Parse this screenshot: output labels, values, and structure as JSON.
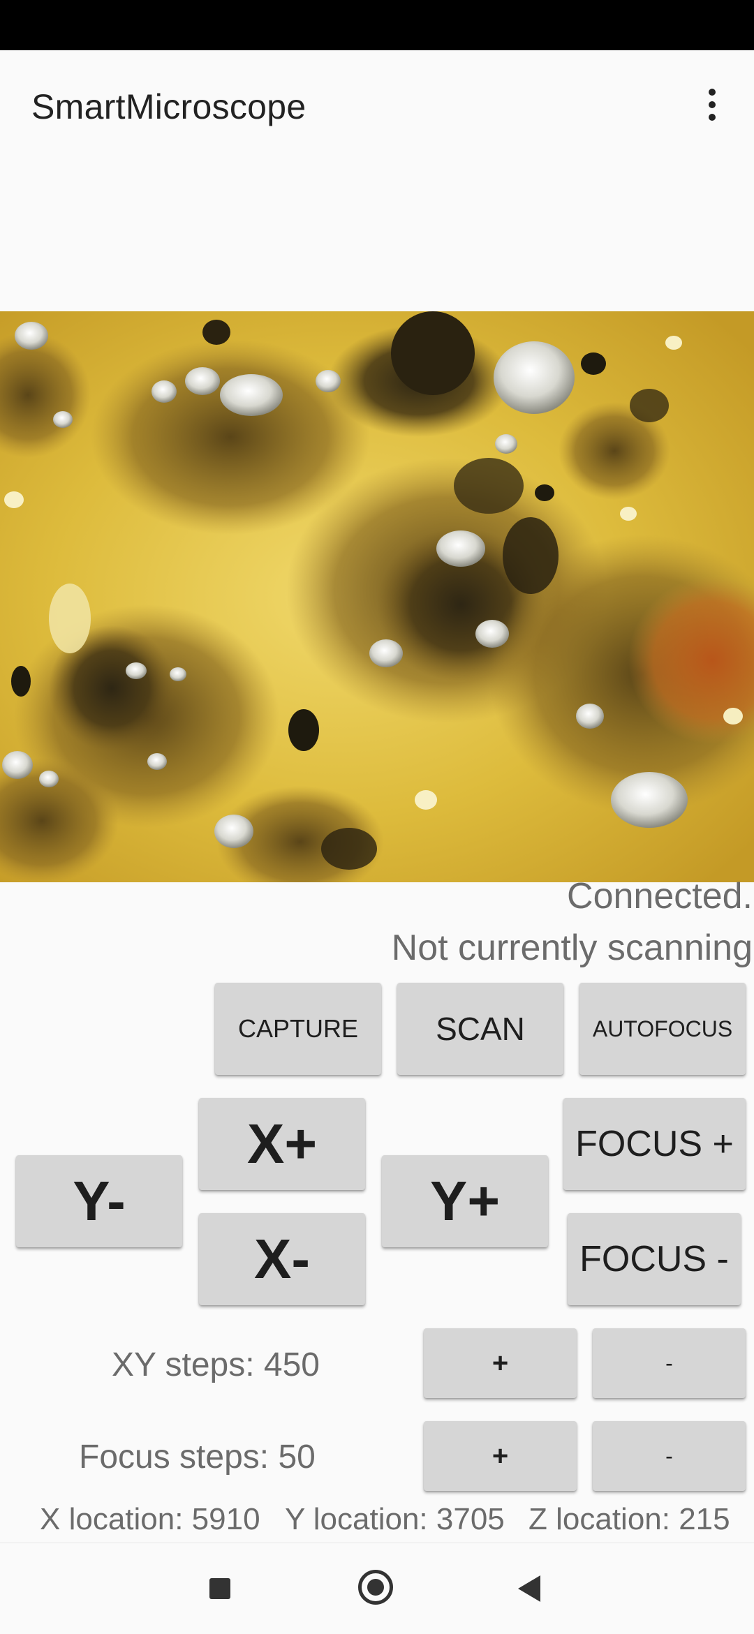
{
  "app": {
    "title": "SmartMicroscope",
    "menu_icon": "more-vert-icon"
  },
  "preview": {
    "description_icon": "microscope-camera-preview"
  },
  "status": {
    "connection": "Connected.",
    "scan_state": "Not currently scanning"
  },
  "actions": {
    "capture": "CAPTURE",
    "scan": "SCAN",
    "autofocus": "AUTOFOCUS"
  },
  "movement": {
    "x_plus": "X+",
    "x_minus": "X-",
    "y_minus": "Y-",
    "y_plus": "Y+",
    "focus_plus": "FOCUS +",
    "focus_minus": "FOCUS -"
  },
  "steps": {
    "xy_label": "XY steps: 450",
    "focus_label": "Focus steps: 50",
    "plus": "+",
    "minus": "-"
  },
  "location": {
    "x": "X location: 5910",
    "y": "Y location: 3705",
    "z": "Z location: 215"
  },
  "nav": {
    "recents_icon": "recents-square-icon",
    "home_icon": "home-circle-icon",
    "back_icon": "back-triangle-icon"
  },
  "colors": {
    "button_bg": "#d6d6d6",
    "status_bar": "#000000",
    "background": "#fafafa",
    "secondary_text": "#6b6b6b"
  }
}
